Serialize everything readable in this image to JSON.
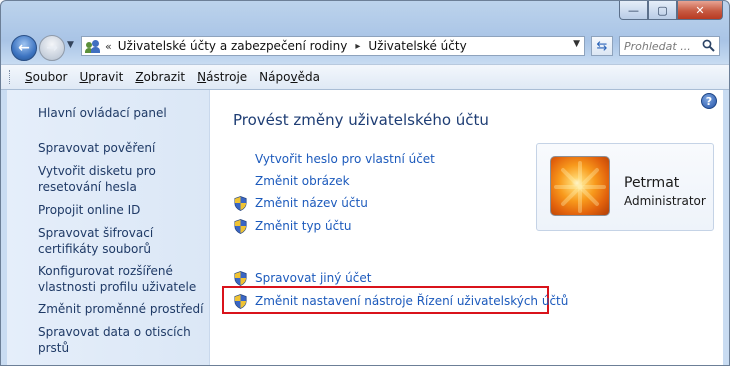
{
  "window": {
    "caption_buttons": {
      "minimize": "—",
      "maximize": "▢",
      "close": "✕"
    }
  },
  "address_bar": {
    "overflow": "«",
    "crumbs": [
      "Uživatelské účty a zabezpečení rodiny",
      "Uživatelské účty"
    ],
    "separator": "▸"
  },
  "search": {
    "placeholder": "Prohledat ..."
  },
  "menu": {
    "items": [
      {
        "pre": "",
        "key": "S",
        "rest": "oubor"
      },
      {
        "pre": "",
        "key": "U",
        "rest": "pravit"
      },
      {
        "pre": "",
        "key": "Z",
        "rest": "obrazit"
      },
      {
        "pre": "",
        "key": "N",
        "rest": "ástroje"
      },
      {
        "pre": "Nápo",
        "key": "v",
        "rest": "ěda"
      }
    ]
  },
  "sidebar": {
    "items": [
      {
        "label": "Hlavní ovládací panel"
      },
      {
        "label": "Spravovat pověření"
      },
      {
        "label": "Vytvořit disketu pro resetování hesla"
      },
      {
        "label": "Propojit online ID"
      },
      {
        "label": "Spravovat šifrovací certifikáty souborů"
      },
      {
        "label": "Konfigurovat rozšířené vlastnosti profilu uživatele"
      },
      {
        "label": "Změnit proměnné prostředí"
      },
      {
        "label": "Spravovat data o otiscích prstů"
      }
    ]
  },
  "main": {
    "heading": "Provést změny uživatelského účtu",
    "tasks": [
      {
        "label": "Vytvořit heslo pro vlastní účet",
        "shield": false
      },
      {
        "label": "Změnit obrázek",
        "shield": false
      },
      {
        "label": "Změnit název účtu",
        "shield": true
      },
      {
        "label": "Změnit typ účtu",
        "shield": true
      }
    ],
    "other_tasks": [
      {
        "label": "Spravovat jiný účet",
        "shield": true
      },
      {
        "label": "Změnit nastavení nástroje Řízení uživatelských účtů",
        "shield": true,
        "highlighted": true
      }
    ]
  },
  "user": {
    "name": "Petrmat",
    "role": "Administrator"
  },
  "colors": {
    "link": "#1c5abc",
    "heading": "#1e3d74",
    "highlight_border": "#d9131b"
  }
}
